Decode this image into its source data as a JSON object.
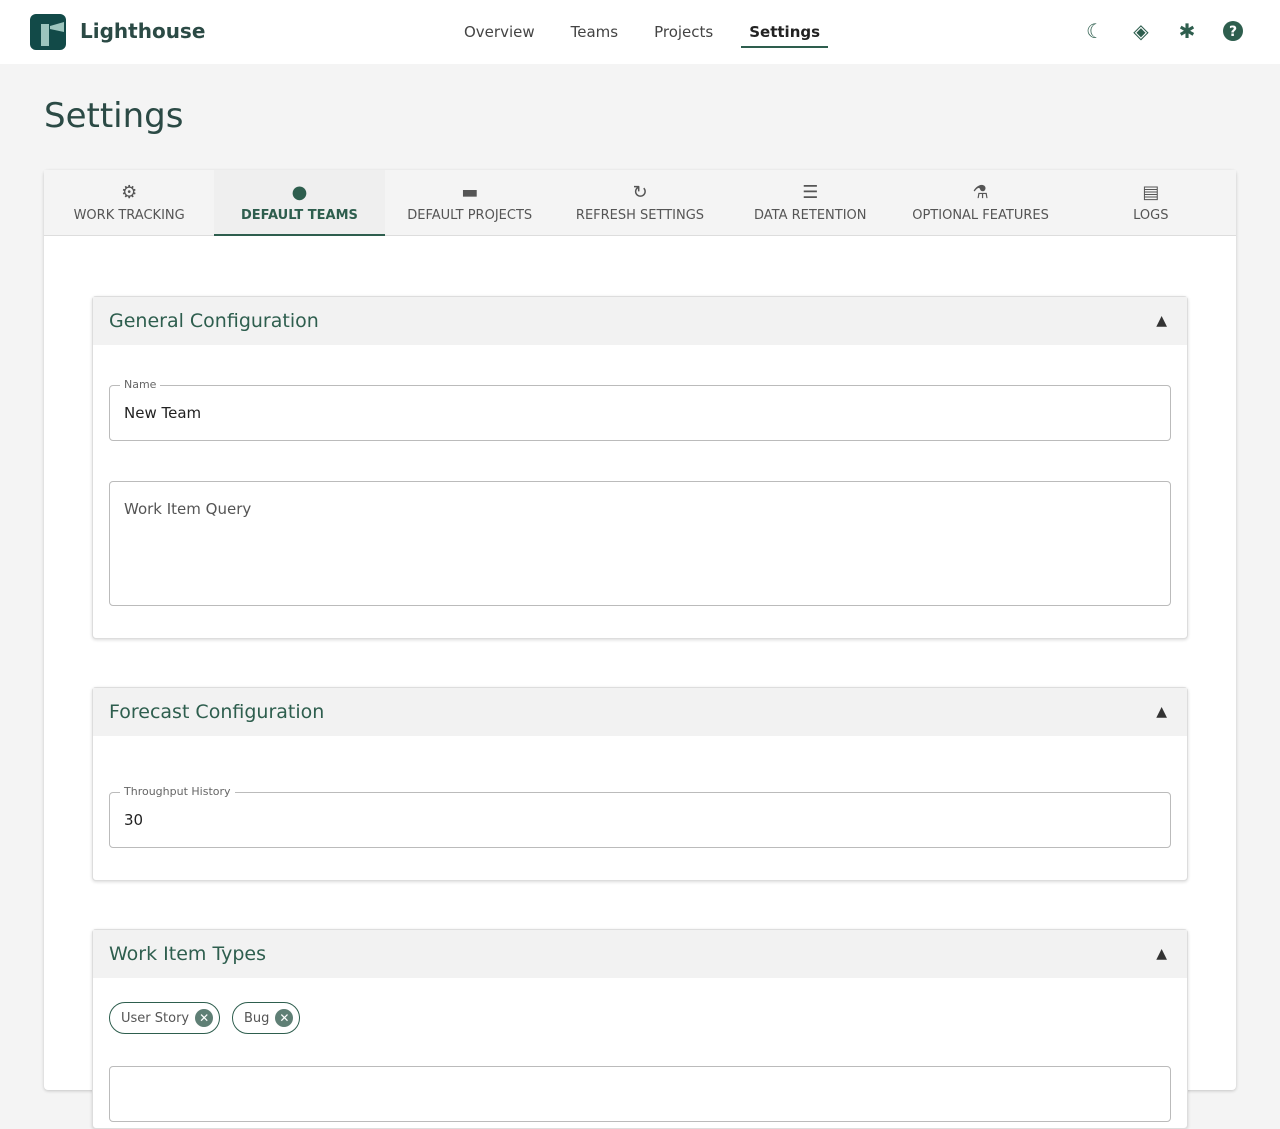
{
  "header": {
    "brand": "Lighthouse",
    "nav": [
      "Overview",
      "Teams",
      "Projects",
      "Settings"
    ],
    "active_nav": "Settings"
  },
  "page_title": "Settings",
  "tabs": [
    {
      "label": "WORK TRACKING",
      "icon": "⚙"
    },
    {
      "label": "DEFAULT TEAMS",
      "icon": "●"
    },
    {
      "label": "DEFAULT PROJECTS",
      "icon": "▬"
    },
    {
      "label": "REFRESH SETTINGS",
      "icon": "↻"
    },
    {
      "label": "DATA RETENTION",
      "icon": "☰"
    },
    {
      "label": "OPTIONAL FEATURES",
      "icon": "⚗"
    },
    {
      "label": "LOGS",
      "icon": "▤"
    }
  ],
  "sections": {
    "general": {
      "title": "General Configuration",
      "name_label": "Name",
      "name_value": "New Team",
      "query_placeholder": "Work Item Query"
    },
    "forecast": {
      "title": "Forecast Configuration",
      "throughput_label": "Throughput History",
      "throughput_value": "30"
    },
    "types": {
      "title": "Work Item Types",
      "chips": [
        "User Story",
        "Bug"
      ]
    }
  },
  "colors": {
    "accent": "#2e5e4e"
  }
}
